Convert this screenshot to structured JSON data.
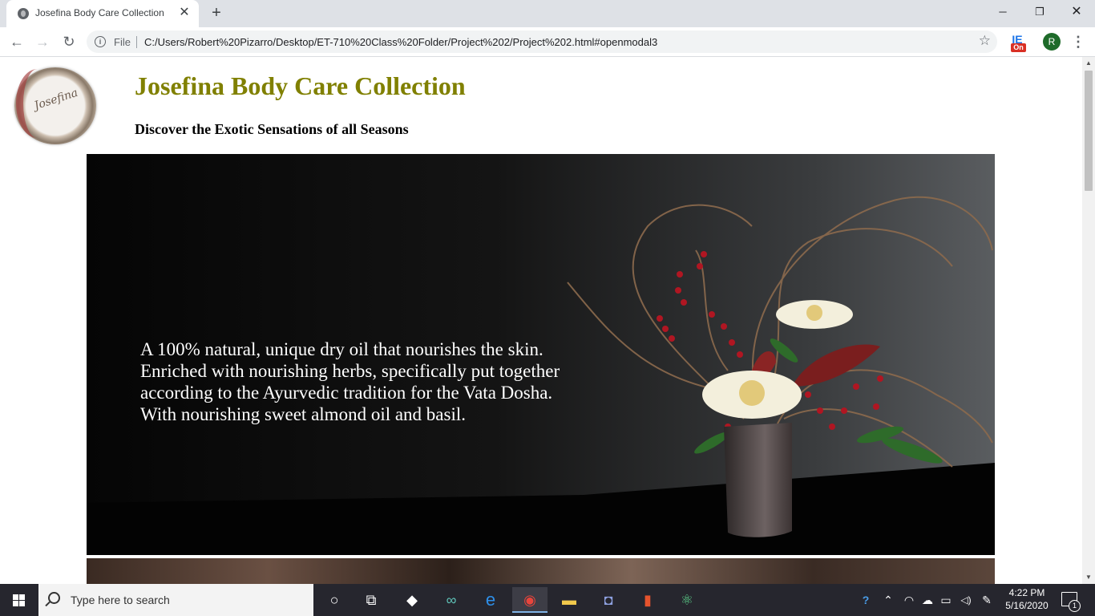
{
  "browser": {
    "tab_title": "Josefina Body Care Collection",
    "tab_close": "✕",
    "new_tab": "+",
    "window_minimize": "─",
    "window_restore": "❐",
    "window_close": "✕",
    "back": "←",
    "forward": "→",
    "reload": "↻",
    "info": "i",
    "scheme_label": "File",
    "url": "C:/Users/Robert%20Pizarro/Desktop/ET-710%20Class%20Folder/Project%202/Project%202.html#openmodal3",
    "bookmark_star": "☆",
    "extension_glyph": "IE",
    "extension_badge": "On",
    "profile_initial": "R",
    "menu": "⋮"
  },
  "page": {
    "logo_text": "Josefina",
    "title": "Josefina Body Care Collection",
    "title_color": "#808000",
    "tagline": "Discover the Exotic Sensations of all Seasons",
    "hero_text": "A 100% natural, unique dry oil that nourishes the skin. Enriched with nourishing herbs, specifically put together according to the Ayurvedic tradition for the Vata Dosha. With nourishing sweet almond oil and basil."
  },
  "scrollbar": {
    "up": "▲",
    "down": "▼"
  },
  "taskbar": {
    "search_placeholder": "Type here to search",
    "cortana": "○",
    "task_view": "⧉",
    "dropbox": "◆",
    "arduino": "∞",
    "edge": "e",
    "chrome": "◉",
    "explorer": "▬",
    "discord": "◘",
    "office": "▮",
    "atom": "⚛",
    "help": "?",
    "tray_chevron": "⌃",
    "wifi": "◠",
    "onedrive": "☁",
    "battery": "▭",
    "volume": "◁)",
    "pen": "✎",
    "time": "4:22 PM",
    "date": "5/16/2020",
    "notification_count": "1"
  }
}
